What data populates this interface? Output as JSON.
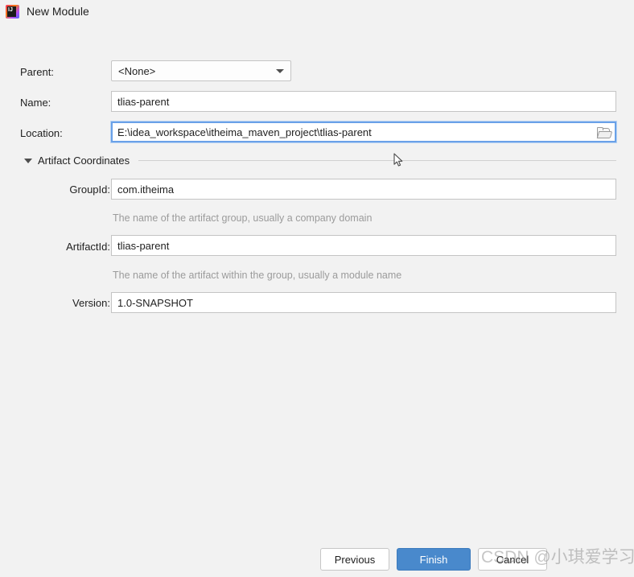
{
  "window": {
    "title": "New Module",
    "icon": "intellij-idea-icon"
  },
  "form": {
    "parent": {
      "label": "Parent:",
      "value": "<None>",
      "options": [
        "<None>"
      ]
    },
    "name": {
      "label": "Name:",
      "value": "tlias-parent",
      "placeholder": ""
    },
    "location": {
      "label": "Location:",
      "value": "E:\\idea_workspace\\itheima_maven_project\\tlias-parent",
      "placeholder": "",
      "browse_icon": "folder-icon",
      "focused": true
    }
  },
  "artifact_coordinates": {
    "section_label": "Artifact Coordinates",
    "expanded": true,
    "group_id": {
      "label": "GroupId:",
      "value": "com.itheima",
      "hint": "The name of the artifact group, usually a company domain"
    },
    "artifact_id": {
      "label": "ArtifactId:",
      "value": "tlias-parent",
      "hint": "The name of the artifact within the group, usually a module name"
    },
    "version": {
      "label": "Version:",
      "value": "1.0-SNAPSHOT",
      "hint": ""
    }
  },
  "buttons": {
    "previous": "Previous",
    "finish": "Finish",
    "cancel": "Cancel"
  },
  "watermark": {
    "text": "CSDN @小琪爱学习"
  },
  "colors": {
    "background": "#f2f2f2",
    "field_background": "#ffffff",
    "field_border": "#c4c4c4",
    "focus_border": "#6aa1e8",
    "primary_button": "#4989cc",
    "hint_text": "#9b9b9b",
    "text": "#1f1f1f"
  }
}
